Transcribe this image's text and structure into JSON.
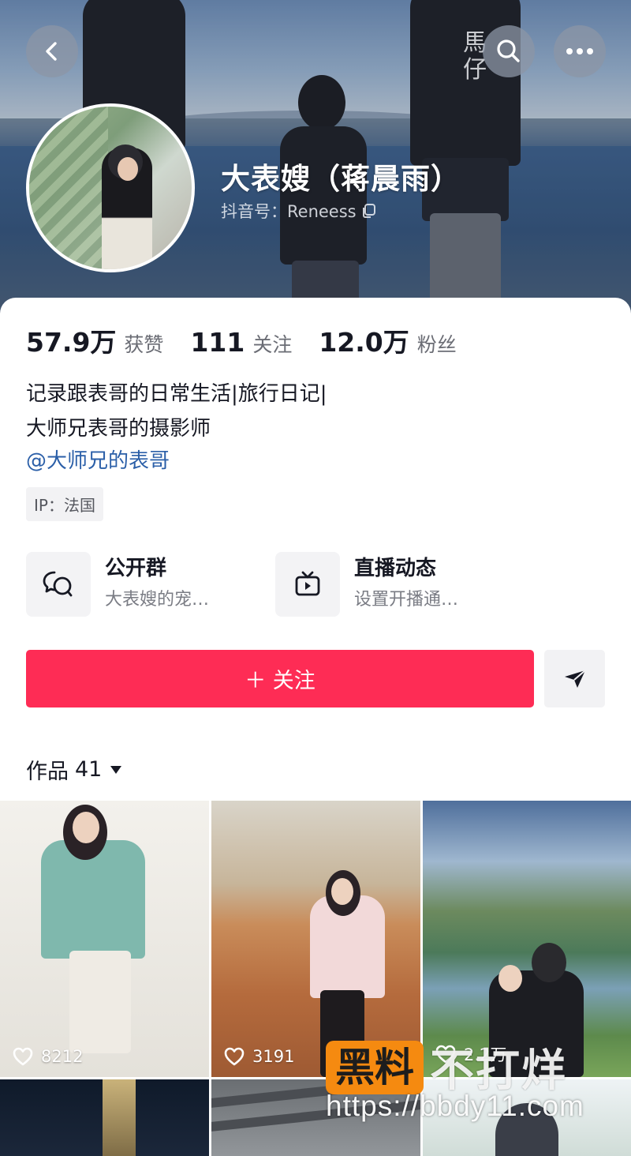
{
  "header": {
    "name": "大表嫂（蒋晨雨）",
    "douyin_id": "抖音号：Reneess",
    "shirt_text": "馬仔"
  },
  "stats": [
    {
      "value": "57.9万",
      "label": "获赞"
    },
    {
      "value": "111",
      "label": "关注"
    },
    {
      "value": "12.0万",
      "label": "粉丝"
    }
  ],
  "bio": {
    "line1": "记录跟表哥的日常生活|旅行日记|",
    "line2": "大师兄表哥的摄影师",
    "mention": "@大师兄的表哥",
    "ip": "IP：法国"
  },
  "features": [
    {
      "title": "公开群",
      "subtitle": "大表嫂的宠…",
      "icon": "chat-bubbles-icon"
    },
    {
      "title": "直播动态",
      "subtitle": "设置开播通…",
      "icon": "tv-icon"
    }
  ],
  "actions": {
    "follow_label": "＋ 关注",
    "share_icon": "send-icon"
  },
  "works": {
    "label": "作品",
    "count": "41"
  },
  "grid": [
    {
      "likes": "8212"
    },
    {
      "likes": "3191"
    },
    {
      "likes": "2.2万"
    }
  ],
  "watermark": {
    "brand": "黑料",
    "text": "不打烊",
    "url": "https://bbdy11.com"
  },
  "colors": {
    "accent": "#fe2c55",
    "link": "#2b5fa8",
    "watermark": "#f58a10"
  }
}
